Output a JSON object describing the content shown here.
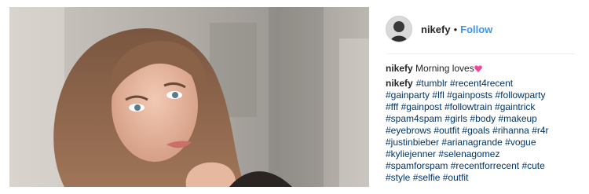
{
  "post": {
    "username": "nikefy",
    "separator": "•",
    "follow_label": "Follow",
    "caption_text": "Morning loves",
    "heart_color": "#f0479a"
  },
  "comment": {
    "username": "nikefy",
    "lines": [
      [
        "#tumblr",
        "#recent4recent"
      ],
      [
        "#gainparty",
        "#lfl",
        "#gainposts",
        "#followparty"
      ],
      [
        "#fff",
        "#gainpost",
        "#followtrain",
        "#gaintrick"
      ],
      [
        "#spam4spam",
        "#girls",
        "#body",
        "#makeup"
      ],
      [
        "#eyebrows",
        "#outfit",
        "#goals",
        "#rihanna",
        "#r4r"
      ],
      [
        "#justinbieber",
        "#arianagrande",
        "#vogue"
      ],
      [
        "#kyliejenner",
        "#selenagomez"
      ],
      [
        "#spamforspam",
        "#recentforrecent",
        "#cute"
      ],
      [
        "#style",
        "#selfie",
        "#outfit"
      ]
    ]
  },
  "colors": {
    "link": "#3897f0",
    "hashtag": "#003569",
    "text": "#262626"
  }
}
